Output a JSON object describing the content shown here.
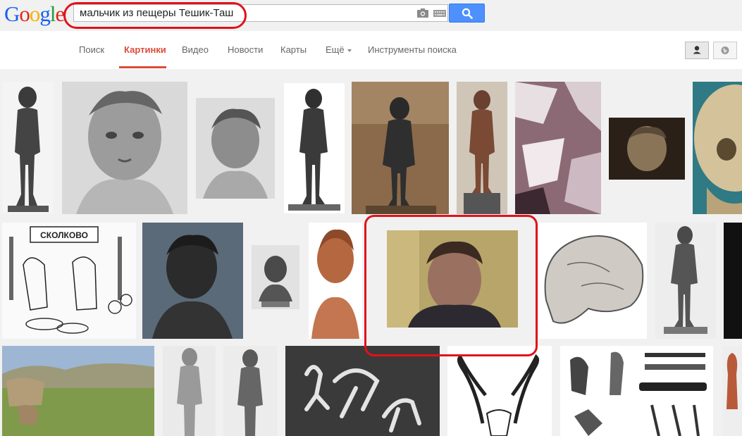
{
  "header": {
    "logo_text": "Google",
    "search_query": "мальчик из пещеры Тешик-Таш"
  },
  "nav": {
    "tabs": [
      {
        "label": "Поиск"
      },
      {
        "label": "Картинки",
        "active": true
      },
      {
        "label": "Видео"
      },
      {
        "label": "Новости"
      },
      {
        "label": "Карты"
      },
      {
        "label": "Ещё"
      },
      {
        "label": "Инструменты поиска"
      }
    ]
  },
  "colors": {
    "logo": [
      "#1a62ee",
      "#e0261b",
      "#f5b400",
      "#1a62ee",
      "#1f9e3a",
      "#e0261b"
    ],
    "accent": "#dd4b39",
    "search_button": "#4d90fe",
    "highlight": "#e0121b"
  },
  "results": {
    "images": [
      {
        "name": "statue-boy-1"
      },
      {
        "name": "bust-photo-bw"
      },
      {
        "name": "bust-sketch"
      },
      {
        "name": "statue-boy-2"
      },
      {
        "name": "statue-museum"
      },
      {
        "name": "statue-bronze"
      },
      {
        "name": "cave-photo"
      },
      {
        "name": "bust-small"
      },
      {
        "name": "skull-photo"
      },
      {
        "name": "skolkovo-cartoon"
      },
      {
        "name": "bust-dark"
      },
      {
        "name": "bust-gray-small"
      },
      {
        "name": "bust-terracotta"
      },
      {
        "name": "man-webcam-portrait"
      },
      {
        "name": "skull-drawing"
      },
      {
        "name": "statue-boy-3"
      },
      {
        "name": "dark-thumb"
      },
      {
        "name": "landscape-photo"
      },
      {
        "name": "statue-boy-4"
      },
      {
        "name": "statue-boy-5"
      },
      {
        "name": "petroglyph"
      },
      {
        "name": "ibex-horns-drawing"
      },
      {
        "name": "artifacts-plate"
      },
      {
        "name": "figure-drawing"
      }
    ]
  },
  "toggles": {
    "personal": "person-icon",
    "hide_personal": "globe-icon"
  }
}
